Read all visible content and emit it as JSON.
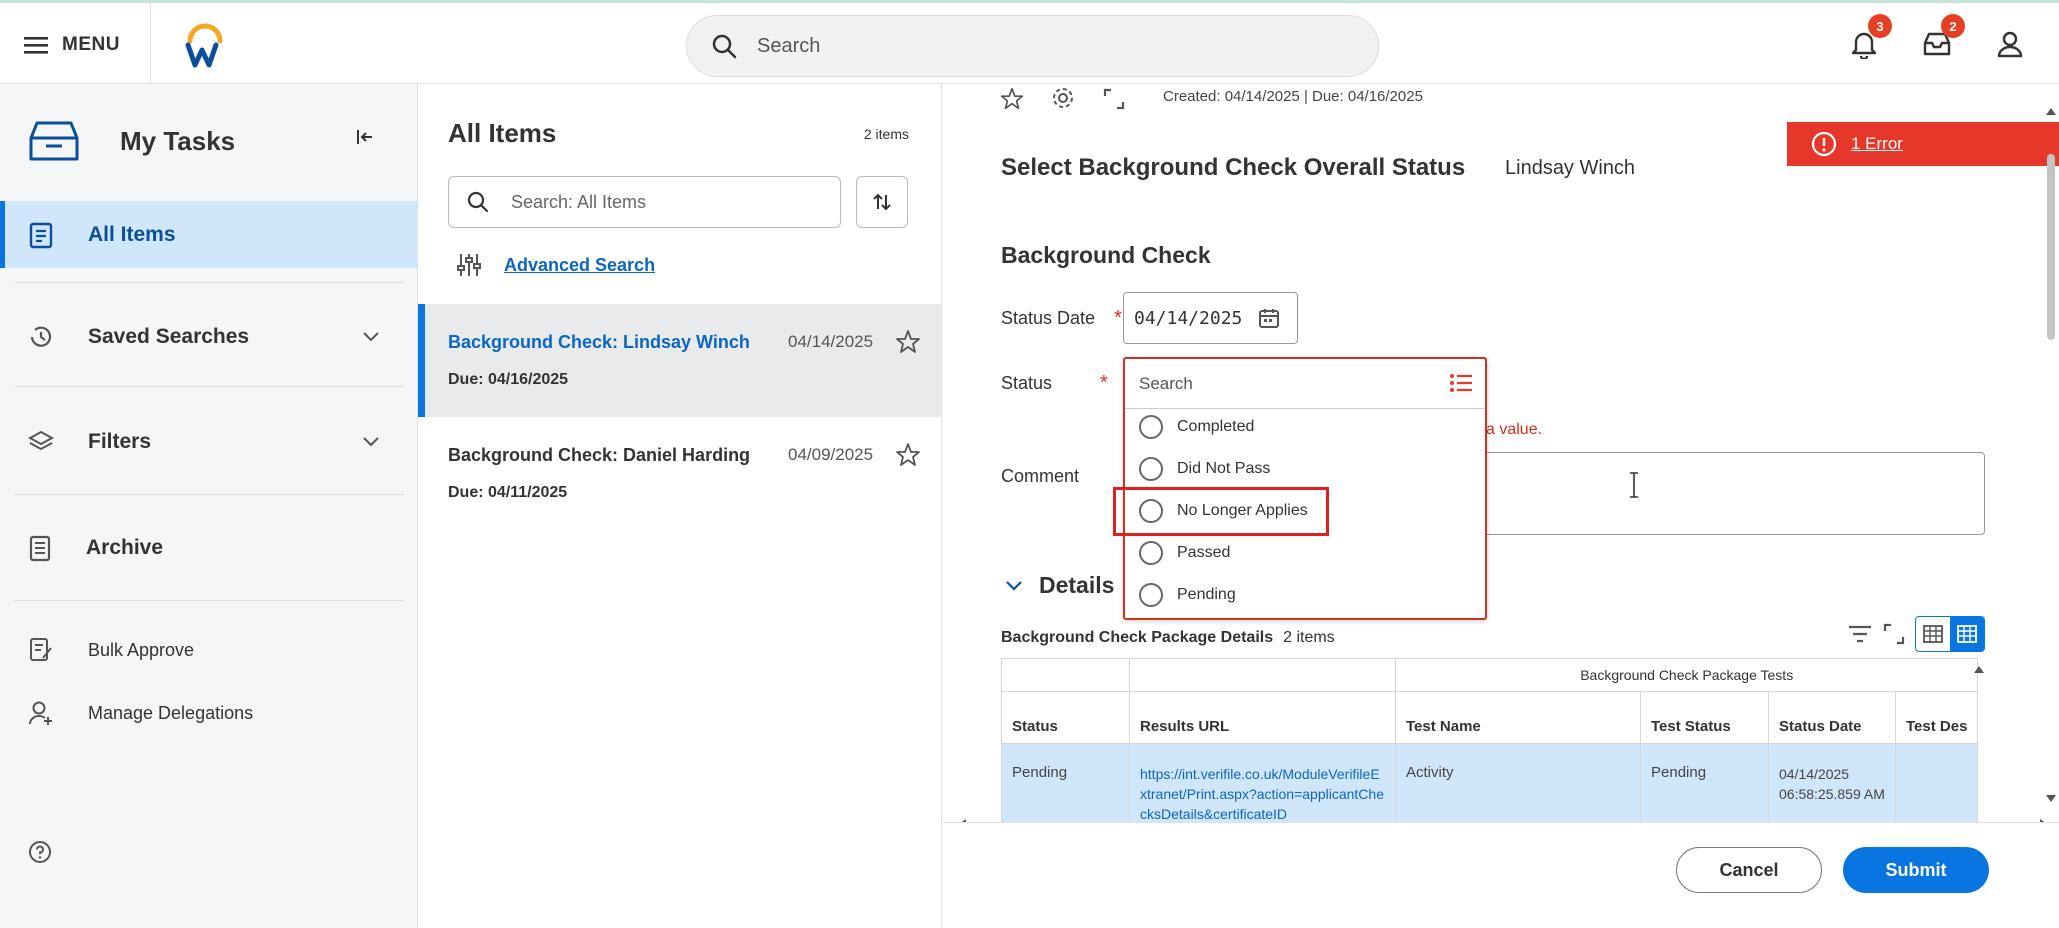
{
  "header": {
    "menu_label": "MENU",
    "search_placeholder": "Search",
    "notifications_count": "3",
    "inbox_count": "2"
  },
  "sidebar": {
    "title": "My Tasks",
    "items": [
      {
        "label": "All Items"
      },
      {
        "label": "Saved Searches"
      },
      {
        "label": "Filters"
      },
      {
        "label": "Archive"
      },
      {
        "label": "Bulk Approve"
      },
      {
        "label": "Manage Delegations"
      }
    ]
  },
  "list": {
    "title": "All Items",
    "count": "2 items",
    "search_placeholder": "Search: All Items",
    "advanced_search": "Advanced Search",
    "items": [
      {
        "title": "Background Check: Lindsay Winch",
        "date": "04/14/2025",
        "due": "Due: 04/16/2025"
      },
      {
        "title": "Background Check: Daniel Harding",
        "date": "04/09/2025",
        "due": "Due: 04/11/2025"
      }
    ]
  },
  "task": {
    "created": "Created: 04/14/2025 | Due: 04/16/2025",
    "error_banner": "1 Error",
    "title": "Select Background Check Overall Status",
    "subject": "Lindsay Winch",
    "section": "Background Check",
    "status_date_label": "Status Date",
    "status_date_value": "04/14/2025",
    "status_label": "Status",
    "comment_label": "Comment",
    "error_fragment": "a value.",
    "details_label": "Details",
    "pkg_label": "Background Check Package Details",
    "pkg_count": "2 items",
    "table": {
      "group_header": "Background Check Package Tests",
      "columns": [
        "Status",
        "Results URL",
        "Test Name",
        "Test Status",
        "Status Date",
        "Test Des"
      ],
      "rows": [
        {
          "status": "Pending",
          "url": "https://int.verifile.co.uk/ModuleVerifileExtranet/Print.aspx?action=applicantChecksDetails&certificateID",
          "test_name": "Activity",
          "test_status": "Pending",
          "status_date": "04/14/2025 06:58:25.859 AM",
          "test_desc": ""
        }
      ]
    },
    "cancel_label": "Cancel",
    "submit_label": "Submit"
  },
  "status_dropdown": {
    "search_placeholder": "Search",
    "options": [
      "Completed",
      "Did Not Pass",
      "No Longer Applies",
      "Passed",
      "Pending"
    ],
    "highlighted": "No Longer Applies"
  },
  "colors": {
    "accent": "#0875e1",
    "error": "#e5372a",
    "active_nav": "#cfe6fb"
  }
}
